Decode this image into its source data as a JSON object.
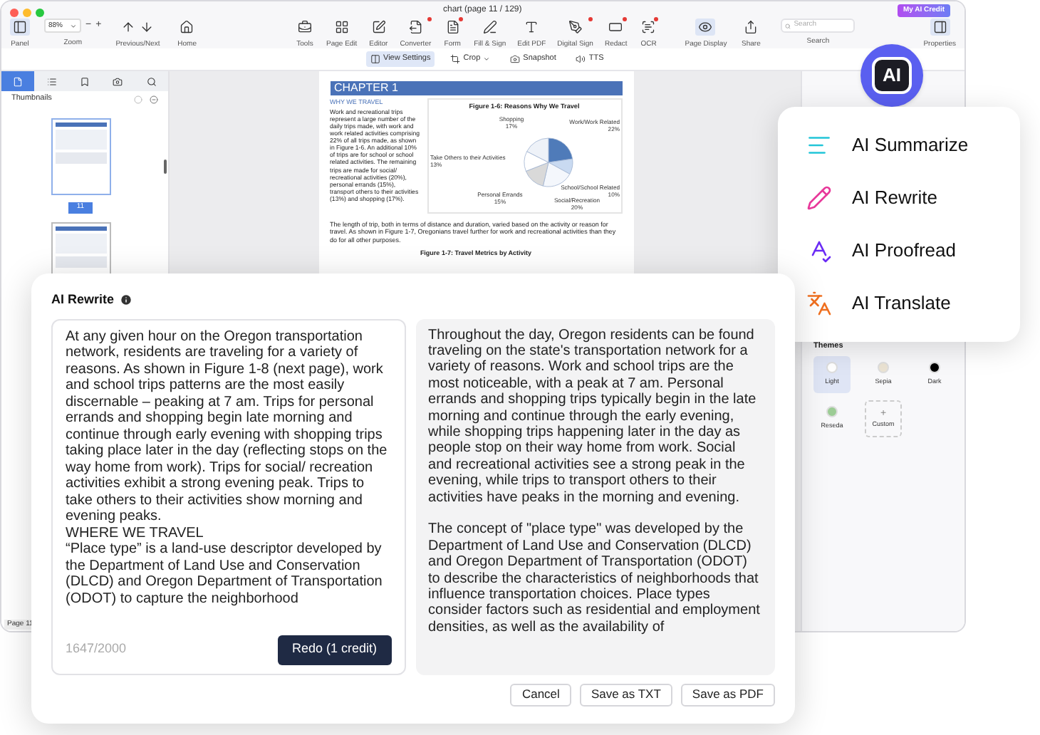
{
  "window": {
    "title": "chart (page 11 / 129)",
    "credit_button": "My AI Credit"
  },
  "toolbar": {
    "left": [
      {
        "label": "Panel",
        "selected": true,
        "badge": false
      },
      {
        "kind": "zoom",
        "label": "Zoom",
        "value": "88%",
        "minus": "−",
        "plus": "+"
      },
      {
        "label": "Previous/Next",
        "selected": false,
        "badge": false
      },
      {
        "label": "Home",
        "selected": false,
        "badge": false
      }
    ],
    "center": [
      {
        "label": "Tools",
        "badge": false
      },
      {
        "label": "Page Edit",
        "badge": false
      },
      {
        "label": "Editor",
        "badge": false
      },
      {
        "label": "Converter",
        "badge": true
      },
      {
        "label": "Form",
        "badge": true
      },
      {
        "label": "Fill & Sign",
        "badge": false
      },
      {
        "label": "Edit PDF",
        "badge": false
      },
      {
        "label": "Digital Sign",
        "badge": true
      },
      {
        "label": "Redact",
        "badge": true
      },
      {
        "label": "OCR",
        "badge": true
      }
    ],
    "right": [
      {
        "label": "Page Display",
        "selected": true
      },
      {
        "label": "Share",
        "selected": false
      },
      {
        "kind": "search",
        "label": "Search",
        "placeholder": "Search"
      },
      {
        "label": "Properties",
        "selected": true
      }
    ]
  },
  "subtoolbar": [
    {
      "label": "View Settings",
      "selected": true,
      "dropdown": false
    },
    {
      "label": "Crop",
      "selected": false,
      "dropdown": true
    },
    {
      "label": "Snapshot",
      "selected": false,
      "dropdown": false
    },
    {
      "label": "TTS",
      "selected": false,
      "dropdown": false
    }
  ],
  "sidebar": {
    "tabs": [
      {
        "selected": true
      },
      {
        "selected": false
      },
      {
        "selected": false
      },
      {
        "selected": false
      },
      {
        "selected": false
      }
    ],
    "title": "Thumbnails",
    "thumbnails": [
      {
        "label": "11",
        "selected": true
      },
      {
        "selected": false
      }
    ],
    "status": "Page 11"
  },
  "document": {
    "heading": "CHAPTER 1",
    "subheading": "WHY WE TRAVEL",
    "paragraph": "Work and recreational trips represent a large number of the daily trips made, with work and work related activities comprising 22% of all trips made, as shown in Figure 1-6. An additional 10% of trips are for school or school related activities. The remaining trips are made for social/ recreational activities (20%), personal errands (15%), transport others to their activities (13%) and shopping (17%).",
    "chart_data": {
      "type": "pie",
      "title": "Figure 1-6: Reasons Why We Travel",
      "categories": [
        "Work/Work Related",
        "School/School Related",
        "Social/Recreation",
        "Personal Errands",
        "Take Others to their Activities",
        "Shopping"
      ],
      "values": [
        22,
        10,
        20,
        15,
        13,
        17
      ],
      "value_labels": [
        "22%",
        "10%",
        "20%",
        "15%",
        "13%",
        "17%"
      ]
    },
    "paragraph_2": "The length of trip, both in terms of distance and duration, varied based on the activity or reason for travel. As shown in Figure 1-7, Oregonians travel further for work and recreational activities than they do for all other purposes.",
    "caption": "Figure 1-7: Travel Metrics by Activity"
  },
  "view_panel": {
    "themes_title": "Themes",
    "themes": [
      {
        "label": "Light",
        "color": "#ffffff",
        "selected": true
      },
      {
        "label": "Sepia",
        "color": "#ebe3d3",
        "selected": false
      },
      {
        "label": "Dark",
        "color": "#000000",
        "selected": false
      },
      {
        "label": "Reseda",
        "color": "#9ccc95",
        "selected": false
      }
    ],
    "custom": {
      "symbol": "+",
      "label": "Custom"
    }
  },
  "ai_logo": {
    "text": "AI"
  },
  "ai_menu": [
    {
      "label": "AI Summarize"
    },
    {
      "label": "AI Rewrite"
    },
    {
      "label": "AI Proofread"
    },
    {
      "label": "AI Translate"
    }
  ],
  "dialog": {
    "title": "AI Rewrite",
    "original_text": "At any given hour on the Oregon transportation network, residents are traveling for a variety of reasons. As shown in Figure 1-8 (next page), work and school trips patterns are the most easily discernable – peaking at 7 am. Trips for personal errands and shopping begin late morning and continue through early evening with shopping trips taking place later in the day (reflecting stops on the way home from work). Trips for social/ recreation activities exhibit a strong evening peak. Trips to take others to their activities show morning and evening peaks.\nWHERE WE TRAVEL\n“Place type” is a land-use descriptor developed by the Department of Land Use and Conservation (DLCD) and Oregon Department of Transportation (ODOT) to capture the neighborhood",
    "counter": "1647/2000",
    "redo_button": "Redo (1 credit)",
    "result_text": "Throughout the day, Oregon residents can be found traveling on the state's transportation network for a variety of reasons. Work and school trips are the most noticeable, with a peak at 7 am. Personal errands and shopping trips typically begin in the late morning and continue through the early evening, while shopping trips happening later in the day as people stop on their way home from work. Social and recreational activities see a strong peak in the evening, while trips to transport others to their activities have peaks in the morning and evening.\n\nThe concept of \"place type\" was developed by the Department of Land Use and Conservation (DLCD) and Oregon Department of Transportation (ODOT) to describe the characteristics of neighborhoods that influence transportation choices. Place types consider factors such as residential and employment densities, as well as the availability of",
    "buttons": [
      "Cancel",
      "Save as TXT",
      "Save as PDF"
    ]
  }
}
